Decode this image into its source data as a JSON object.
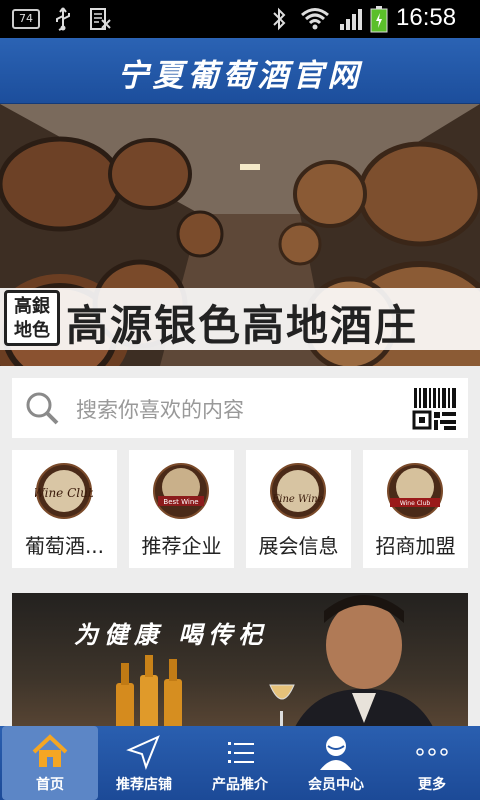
{
  "status_bar": {
    "notification_badge": "74",
    "time": "16:58",
    "icons": [
      "usb-icon",
      "document-icon",
      "bluetooth-icon",
      "wifi-icon",
      "signal-icon",
      "battery-icon"
    ]
  },
  "header": {
    "title": "宁夏葡萄酒官网"
  },
  "banner": {
    "seal_text_line1": "高銀",
    "seal_text_line2": "地色",
    "caption": "高源银色高地酒庄",
    "slide_count": 4,
    "active_slide": 1
  },
  "search": {
    "placeholder": "搜索你喜欢的内容",
    "icons": [
      "search-icon",
      "qr-scan-icon"
    ]
  },
  "categories": [
    {
      "label": "葡萄酒...",
      "logo_text": "Wine Club"
    },
    {
      "label": "推荐企业",
      "logo_text": "Best Wine"
    },
    {
      "label": "展会信息",
      "logo_text": "Fine Wine"
    },
    {
      "label": "招商加盟",
      "logo_text": "Wine Club"
    }
  ],
  "ad": {
    "slogan": "为健康  喝传杞"
  },
  "bottom_nav": [
    {
      "label": "首页",
      "icon": "home-icon",
      "active": true
    },
    {
      "label": "推荐店铺",
      "icon": "navigation-arrow-icon",
      "active": false
    },
    {
      "label": "产品推介",
      "icon": "list-icon",
      "active": false
    },
    {
      "label": "会员中心",
      "icon": "user-icon",
      "active": false
    },
    {
      "label": "更多",
      "icon": "more-dots-icon",
      "active": false
    }
  ],
  "colors": {
    "brand_blue": "#2357a8",
    "background": "#ededed",
    "nav_active": "#5c86c6"
  }
}
